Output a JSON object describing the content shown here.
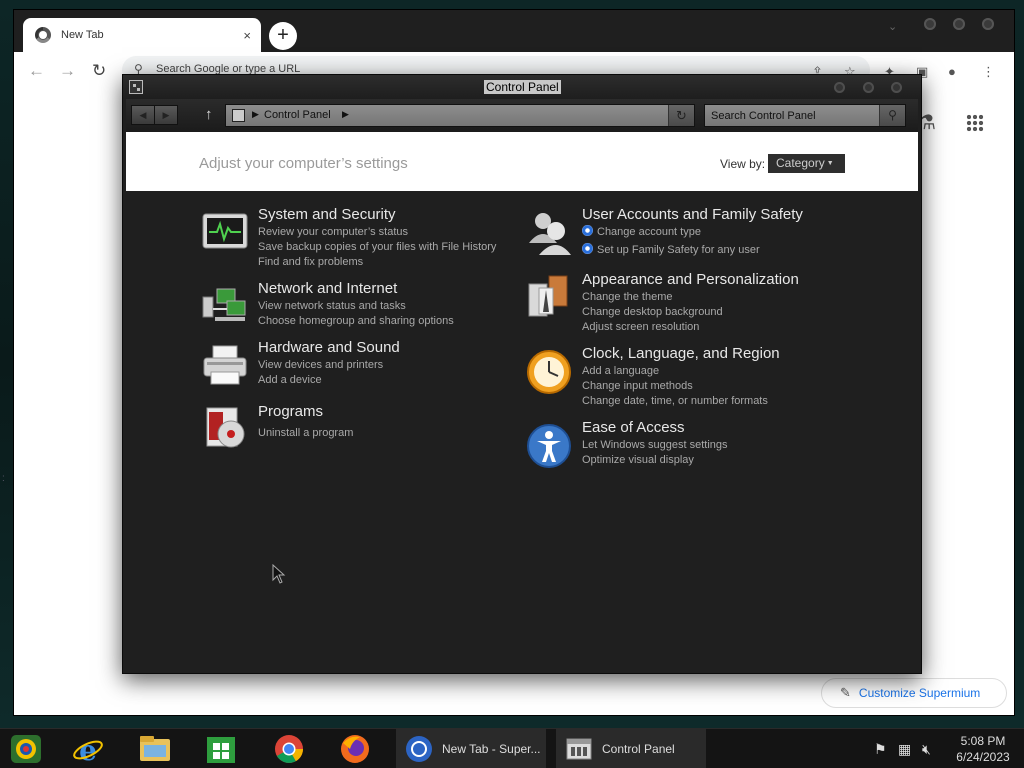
{
  "browser": {
    "tab_title": "New Tab",
    "tab_close": "×",
    "new_tab": "+",
    "omnibox_placeholder": "Search Google or type a URL",
    "customize_label": "Customize Supermium"
  },
  "control_panel": {
    "window_title": "Control Panel",
    "breadcrumb": "Control Panel",
    "search_placeholder": "Search Control Panel",
    "heading": "Adjust your computer’s settings",
    "view_by_label": "View by:",
    "view_by_value": "Category",
    "categories": [
      {
        "title": "System and Security",
        "icon": "system-security-icon",
        "links": [
          "Review your computer’s status",
          "Save backup copies of your files with File History",
          "Find and fix problems"
        ]
      },
      {
        "title": "Network and Internet",
        "icon": "network-icon",
        "links": [
          "View network status and tasks",
          "Choose homegroup and sharing options"
        ]
      },
      {
        "title": "Hardware and Sound",
        "icon": "printer-icon",
        "links": [
          "View devices and printers",
          "Add a device"
        ]
      },
      {
        "title": "Programs",
        "icon": "programs-icon",
        "links": [
          "Uninstall a program"
        ]
      },
      {
        "title": "User Accounts and Family Safety",
        "icon": "users-icon",
        "links": [
          "Change account type",
          "Set up Family Safety for any user"
        ]
      },
      {
        "title": "Appearance and Personalization",
        "icon": "appearance-icon",
        "links": [
          "Change the theme",
          "Change desktop background",
          "Adjust screen resolution"
        ]
      },
      {
        "title": "Clock, Language, and Region",
        "icon": "clock-icon",
        "links": [
          "Add a language",
          "Change input methods",
          "Change date, time, or number formats"
        ]
      },
      {
        "title": "Ease of Access",
        "icon": "accessibility-icon",
        "links": [
          "Let Windows suggest settings",
          "Optimize visual display"
        ]
      }
    ]
  },
  "taskbar": {
    "tasks": [
      {
        "label": "New Tab - Super...",
        "icon": "chrome-icon"
      },
      {
        "label": "Control Panel",
        "icon": "control-panel-icon"
      }
    ],
    "clock_time": "5:08 PM",
    "clock_date": "6/24/2023"
  }
}
